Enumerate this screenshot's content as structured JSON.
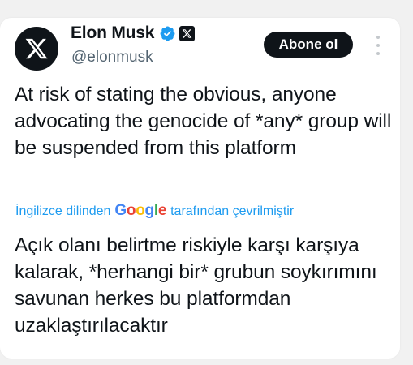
{
  "author": {
    "name": "Elon Musk",
    "handle": "@elonmusk",
    "avatar_icon": "x-logo-icon",
    "verified_icon": "verified-badge-icon",
    "affiliate_icon": "x-affiliate-badge-icon"
  },
  "actions": {
    "follow_label": "Abone ol",
    "more_icon": "more-options-icon"
  },
  "tweet": {
    "text": "At risk of stating the obvious, anyone advocating the genocide of *any* group will be suspended from this platform"
  },
  "translation": {
    "prefix": "İngilizce dilinden",
    "provider": "Google",
    "suffix": "tarafından çevrilmiştir",
    "text": "Açık olanı belirtme riskiyle karşı karşıya kalarak, *herhangi bir* grubun soykırımını savunan herkes bu platformdan uzaklaştırılacaktır"
  },
  "colors": {
    "link": "#1d9bf0",
    "verified": "#1d9bf0",
    "button_bg": "#0f1419",
    "text": "#0f1419",
    "secondary_text": "#536471"
  }
}
